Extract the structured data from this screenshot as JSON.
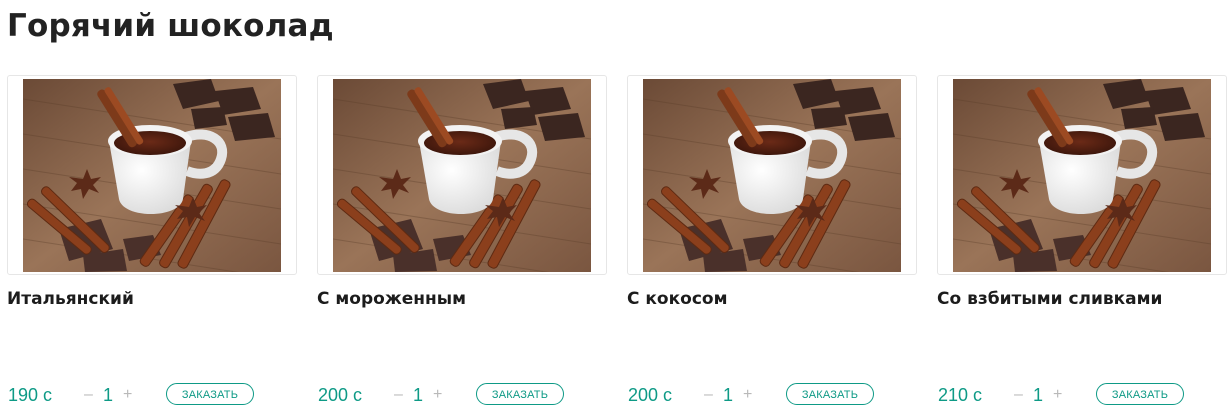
{
  "section": {
    "title": "Горячий шоколад"
  },
  "accent_color": "#0e9a86",
  "products": [
    {
      "name": "Итальянский",
      "price": "190 с",
      "qty": "1",
      "minus": "–",
      "plus": "+",
      "order_label": "ЗАКАЗАТЬ",
      "image": "hot-chocolate-photo"
    },
    {
      "name": "С мороженным",
      "price": "200 с",
      "qty": "1",
      "minus": "–",
      "plus": "+",
      "order_label": "ЗАКАЗАТЬ",
      "image": "hot-chocolate-photo"
    },
    {
      "name": "С кокосом",
      "price": "200 с",
      "qty": "1",
      "minus": "–",
      "plus": "+",
      "order_label": "ЗАКАЗАТЬ",
      "image": "hot-chocolate-photo"
    },
    {
      "name": "Со взбитыми сливками",
      "price": "210 с",
      "qty": "1",
      "minus": "–",
      "plus": "+",
      "order_label": "ЗАКАЗАТЬ",
      "image": "hot-chocolate-photo"
    }
  ]
}
